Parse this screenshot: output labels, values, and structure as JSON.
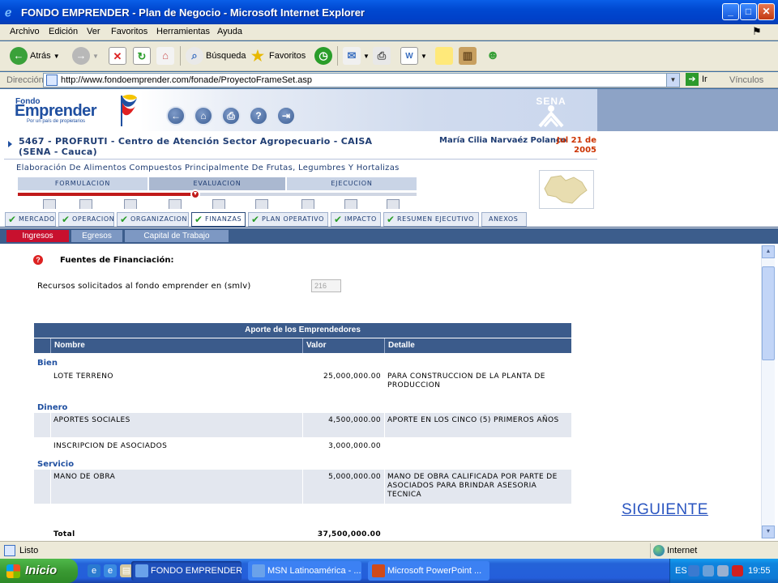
{
  "window": {
    "title": "FONDO EMPRENDER - Plan de Negocio - Microsoft Internet Explorer"
  },
  "menu": [
    "Archivo",
    "Edición",
    "Ver",
    "Favoritos",
    "Herramientas",
    "Ayuda"
  ],
  "toolbar": {
    "back": "Atrás",
    "search": "Búsqueda",
    "favorites": "Favoritos"
  },
  "address": {
    "label": "Dirección",
    "url": "http://www.fondoemprender.com/fonade/ProyectoFrameSet.asp",
    "go": "Ir",
    "links": "Vínculos"
  },
  "site": {
    "logo_small": "Fondo",
    "logo_big": "Emprender",
    "logo_tag": "Por un país de propietarios",
    "sena": "SENA",
    "project": "5467 - PROFRUTI - Centro de Atención Sector Agropecuario - CAISA (SENA - Cauca)",
    "user": "María Cilia Narvaéz Polanco",
    "date": "Jul 21 de 2005",
    "description": "Elaboración De Alimentos Compuestos Principalmente De Frutas, Legumbres Y Hortalizas",
    "phases": [
      "FORMULACION",
      "EVALUACION",
      "EJECUCION"
    ],
    "phase_progress_fraction": 0.44
  },
  "tabs": [
    {
      "label": "MERCADO",
      "checked": true
    },
    {
      "label": "OPERACION",
      "checked": true
    },
    {
      "label": "ORGANIZACION",
      "checked": true
    },
    {
      "label": "FINANZAS",
      "checked": true,
      "active": true
    },
    {
      "label": "PLAN OPERATIVO",
      "checked": true
    },
    {
      "label": "IMPACTO",
      "checked": true
    },
    {
      "label": "RESUMEN EJECUTIVO",
      "checked": true
    },
    {
      "label": "ANEXOS",
      "checked": false
    }
  ],
  "subtabs": [
    {
      "label": "Ingresos",
      "active": true
    },
    {
      "label": "Egresos",
      "active": false
    },
    {
      "label": "Capital de Trabajo",
      "active": false
    }
  ],
  "form": {
    "section_title": "Fuentes de Financiación:",
    "recursos_label": "Recursos solicitados al fondo emprender en (smlv)",
    "recursos_value": "216"
  },
  "table": {
    "title": "Aporte de los Emprendedores",
    "headers": [
      "Nombre",
      "Valor",
      "Detalle"
    ],
    "categories": {
      "bien": "Bien",
      "dinero": "Dinero",
      "servicio": "Servicio"
    },
    "rows": [
      {
        "nombre": "LOTE TERRENO",
        "valor": "25,000,000.00",
        "detalle": "PARA CONSTRUCCION DE LA PLANTA DE PRODUCCION"
      },
      {
        "nombre": "APORTES SOCIALES",
        "valor": "4,500,000.00",
        "detalle": "APORTE EN LOS CINCO (5) PRIMEROS AÑOS"
      },
      {
        "nombre": "INSCRIPCION DE ASOCIADOS",
        "valor": "3,000,000.00",
        "detalle": ""
      },
      {
        "nombre": "MANO DE OBRA",
        "valor": "5,000,000.00",
        "detalle": "MANO DE OBRA CALIFICADA POR PARTE DE ASOCIADOS PARA BRINDAR ASESORIA TECNICA"
      }
    ],
    "total_label": "Total",
    "total_value": "37,500,000.00"
  },
  "siguiente": "SIGUIENTE",
  "status": {
    "left": "Listo",
    "zone": "Internet"
  },
  "taskbar": {
    "start": "Inicio",
    "tasks": [
      "FONDO EMPRENDER ...",
      "MSN Latinoamérica - ...",
      "Microsoft PowerPoint ..."
    ],
    "lang": "ES",
    "clock": "19:55"
  },
  "colors": {
    "accent": "#3b5b8b",
    "active_tab": "#c8102e",
    "link": "#2a55c0"
  }
}
